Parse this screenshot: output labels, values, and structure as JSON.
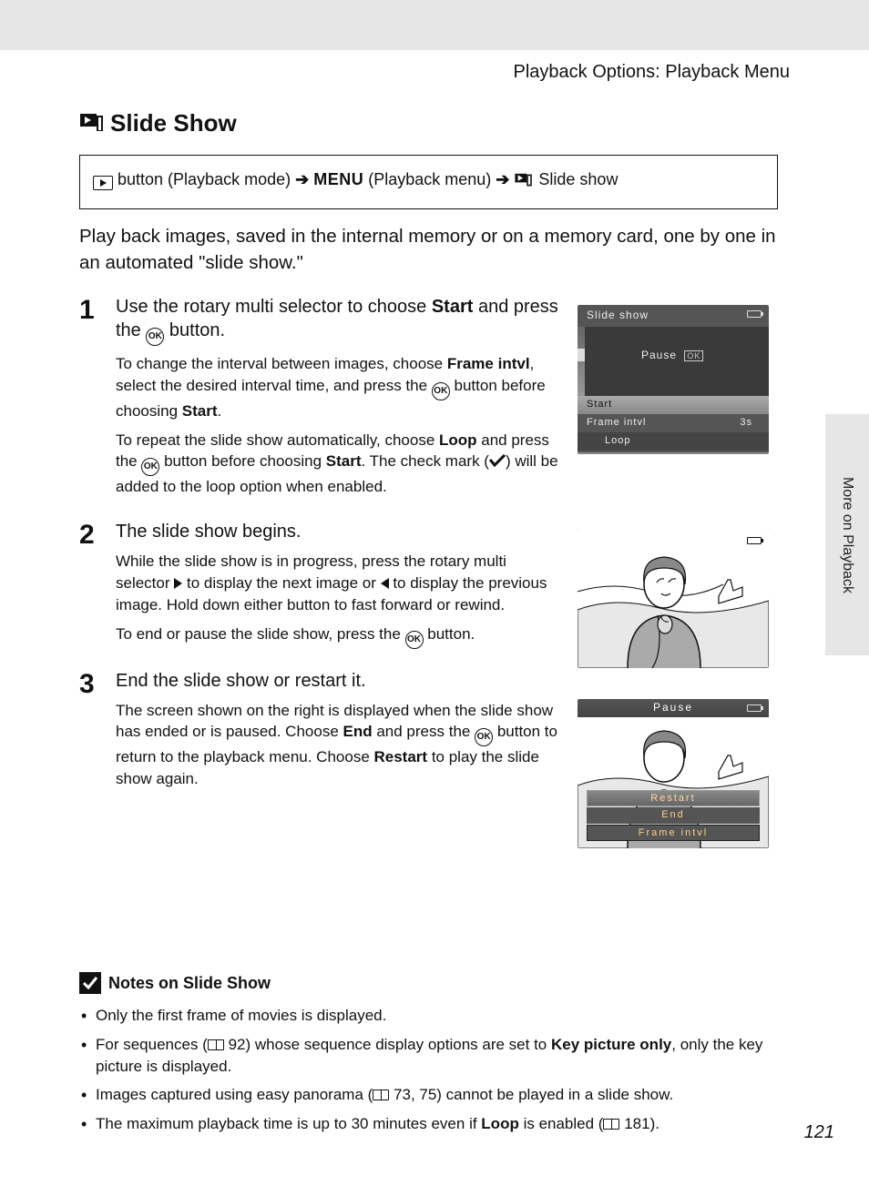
{
  "header": {
    "section": "Playback Options: Playback Menu"
  },
  "title": "Slide Show",
  "breadcrumb": {
    "part1": " button (Playback mode) ",
    "menu": "MENU",
    "part2": " (Playback menu) ",
    "part3": " Slide show"
  },
  "intro": "Play back images, saved in the internal memory or on a memory card, one by one in an automated \"slide show.\"",
  "steps": [
    {
      "num": "1",
      "head_pre": "Use the rotary multi selector to choose ",
      "head_bold": "Start",
      "head_post": " and press the ",
      "head_tail": " button.",
      "p1_a": "To change the interval between images, choose ",
      "p1_b1": "Frame intvl",
      "p1_c": ", select the desired interval time, and press the ",
      "p1_d": " button before choosing ",
      "p1_b2": "Start",
      "p1_e": ".",
      "p2_a": "To repeat the slide show automatically, choose ",
      "p2_b1": "Loop",
      "p2_c": " and press the ",
      "p2_d": " button before choosing ",
      "p2_b2": "Start",
      "p2_e": ". The check mark (",
      "p2_f": ") will be added to the loop option when enabled."
    },
    {
      "num": "2",
      "head": "The slide show begins.",
      "p1_a": "While the slide show is in progress, press the rotary multi selector ",
      "p1_b": " to display the next image or ",
      "p1_c": " to display the previous image. Hold down either button to fast forward or rewind.",
      "p2_a": "To end or pause the slide show, press the ",
      "p2_b": " button."
    },
    {
      "num": "3",
      "head": "End the slide show or restart it.",
      "p1_a": "The screen shown on the right is displayed when the slide show has ended or is paused. Choose ",
      "p1_b1": "End",
      "p1_c": " and press the ",
      "p1_d": " button to return to the playback menu. Choose ",
      "p1_b2": "Restart",
      "p1_e": " to play the slide show again."
    }
  ],
  "lcd1": {
    "title": "Slide show",
    "pause": "Pause",
    "ok": "OK",
    "start": "Start",
    "frame": "Frame intvl",
    "frame_val": "3s",
    "loop": "Loop"
  },
  "lcd3": {
    "pause": "Pause",
    "restart": "Restart",
    "end": "End",
    "frame": "Frame intvl"
  },
  "side_tab": "More on Playback",
  "notes": {
    "title": "Notes on Slide Show",
    "items": [
      {
        "a": "Only the first frame of movies is displayed."
      },
      {
        "a": "For sequences (",
        "ref1": "92",
        "b": ") whose sequence display options are set to ",
        "bold": "Key picture only",
        "c": ", only the key picture is displayed."
      },
      {
        "a": "Images captured using easy panorama (",
        "ref1": "73, 75",
        "b": ") cannot be played in a slide show."
      },
      {
        "a": "The maximum playback time is up to 30 minutes even if ",
        "bold": "Loop",
        "b": " is enabled (",
        "ref1": "181",
        "c": ")."
      }
    ]
  },
  "page_number": "121"
}
